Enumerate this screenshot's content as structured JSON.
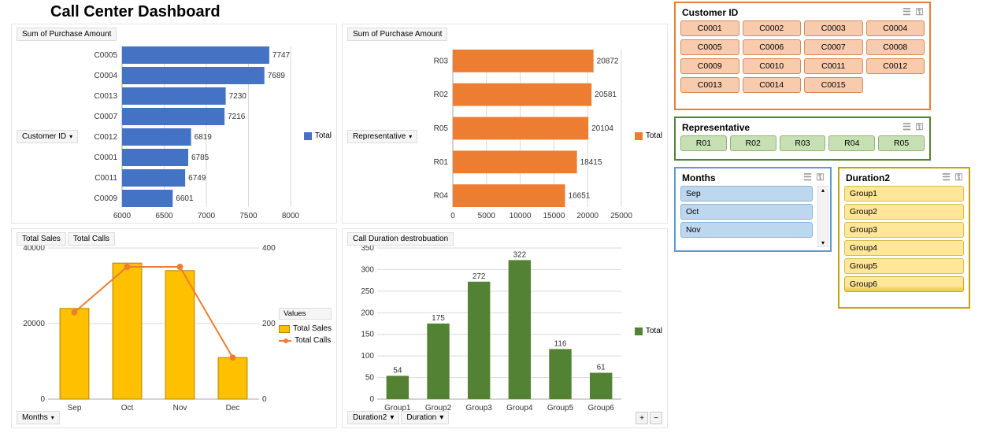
{
  "page_title": "Call Center Dashboard",
  "chart_data": [
    {
      "id": "chart_customer_purchase",
      "type": "bar",
      "orientation": "horizontal",
      "title": "Sum of Purchase Amount",
      "axis_label": "Customer ID",
      "categories": [
        "C0005",
        "C0004",
        "C0013",
        "C0007",
        "C0012",
        "C0001",
        "C0011",
        "C0009"
      ],
      "values": [
        7747,
        7689,
        7230,
        7216,
        6819,
        6785,
        6749,
        6601
      ],
      "xlim": [
        6000,
        8000
      ],
      "x_ticks": [
        6000,
        6500,
        7000,
        7500,
        8000
      ],
      "legend": [
        "Total"
      ],
      "color": "#4472c4"
    },
    {
      "id": "chart_rep_purchase",
      "type": "bar",
      "orientation": "horizontal",
      "title": "Sum of Purchase Amount",
      "axis_label": "Representative",
      "categories": [
        "R03",
        "R02",
        "R05",
        "R01",
        "R04"
      ],
      "values": [
        20872,
        20581,
        20104,
        18415,
        16651
      ],
      "xlim": [
        0,
        25000
      ],
      "x_ticks": [
        0,
        5000,
        10000,
        15000,
        20000,
        25000
      ],
      "legend": [
        "Total"
      ],
      "color": "#ed7d31"
    },
    {
      "id": "chart_monthly",
      "type": "combo",
      "title_tabs": [
        "Total Sales",
        "Total Calls"
      ],
      "axis_label": "Months",
      "categories": [
        "Sep",
        "Oct",
        "Nov",
        "Dec"
      ],
      "series": [
        {
          "name": "Total Sales",
          "type": "bar",
          "axis": "left",
          "color": "#ffc000",
          "values": [
            24000,
            36000,
            34000,
            11000
          ]
        },
        {
          "name": "Total Calls",
          "type": "line",
          "axis": "right",
          "color": "#ed7d31",
          "values": [
            230,
            350,
            350,
            110
          ]
        }
      ],
      "ylim_left": [
        0,
        40000
      ],
      "y_ticks_left": [
        0,
        20000,
        40000
      ],
      "ylim_right": [
        0,
        400
      ],
      "y_ticks_right": [
        0,
        200,
        400
      ],
      "legend_title": "Values"
    },
    {
      "id": "chart_duration",
      "type": "bar",
      "orientation": "vertical",
      "title": "Call Duration destrobuation",
      "axis_labels": [
        "Duration2",
        "Duration"
      ],
      "categories": [
        "Group1",
        "Group2",
        "Group3",
        "Group4",
        "Group5",
        "Group6"
      ],
      "values": [
        54,
        175,
        272,
        322,
        116,
        61
      ],
      "ylim": [
        0,
        350
      ],
      "y_ticks": [
        0,
        50,
        100,
        150,
        200,
        250,
        300,
        350
      ],
      "legend": [
        "Total"
      ],
      "color": "#548235"
    }
  ],
  "slicers": {
    "customer_id": {
      "title": "Customer ID",
      "items": [
        "C0001",
        "C0002",
        "C0003",
        "C0004",
        "C0005",
        "C0006",
        "C0007",
        "C0008",
        "C0009",
        "C0010",
        "C0011",
        "C0012",
        "C0013",
        "C0014",
        "C0015"
      ]
    },
    "representative": {
      "title": "Representative",
      "items": [
        "R01",
        "R02",
        "R03",
        "R04",
        "R05"
      ]
    },
    "months": {
      "title": "Months",
      "items": [
        "Sep",
        "Oct",
        "Nov"
      ]
    },
    "duration2": {
      "title": "Duration2",
      "items": [
        "Group1",
        "Group2",
        "Group3",
        "Group4",
        "Group5",
        "Group6"
      ]
    }
  },
  "icons": {
    "multi": "≡",
    "clear": "⯉",
    "drop": "▾",
    "up": "▴",
    "down": "▾",
    "plus": "+",
    "minus": "−"
  }
}
